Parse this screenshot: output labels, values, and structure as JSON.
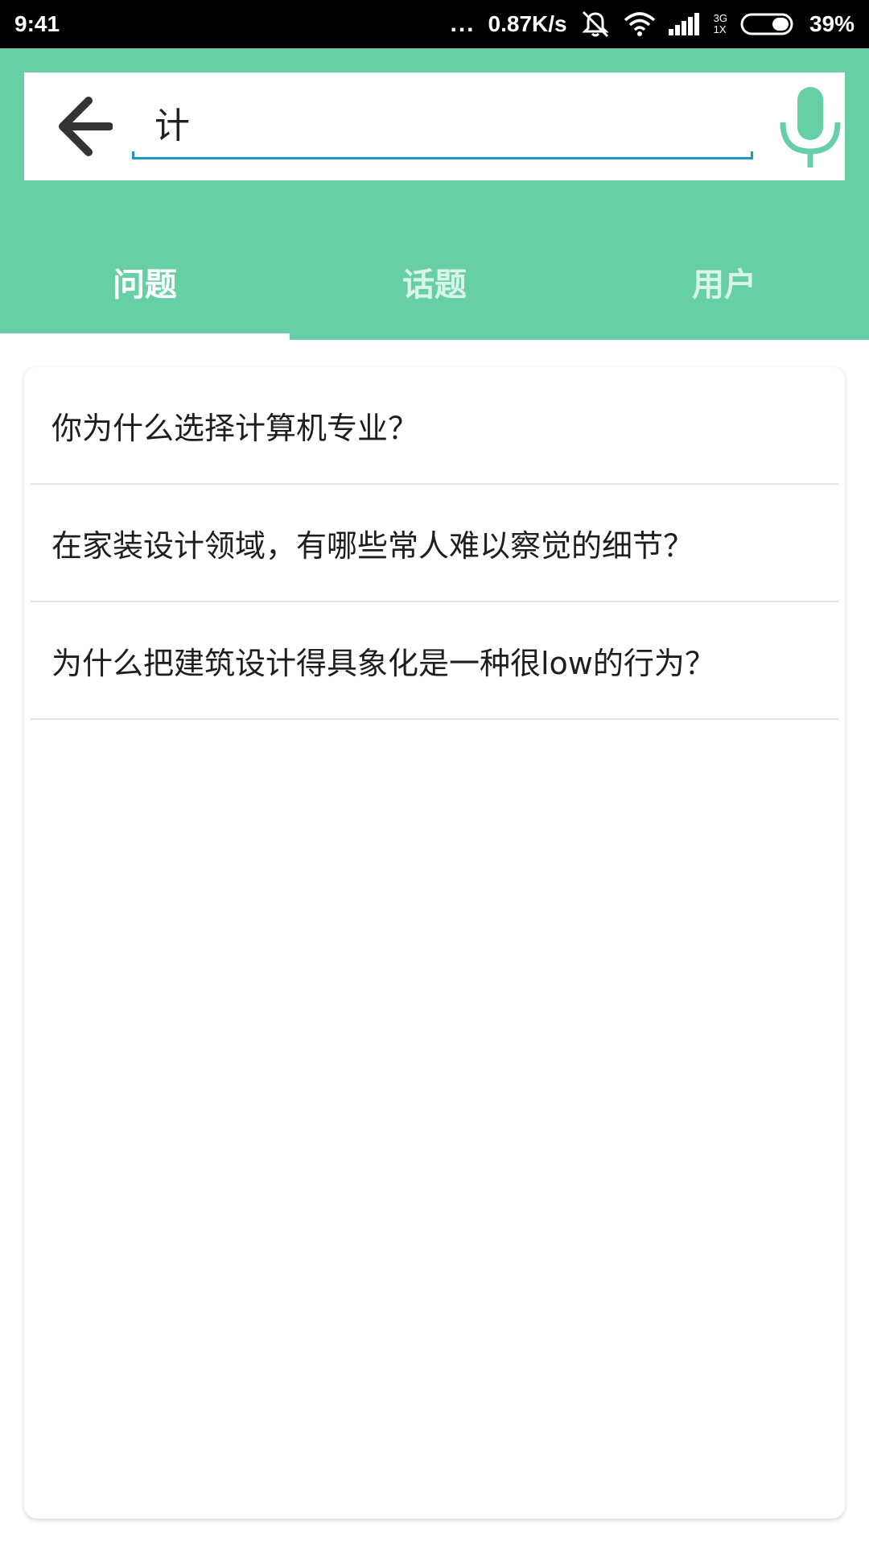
{
  "status_bar": {
    "time": "9:41",
    "more": "...",
    "net_speed": "0.87K/s",
    "network_type": "3G",
    "sim_slot": "1X",
    "battery": "39%",
    "icons": [
      "dots-icon",
      "mute-vibrate-icon",
      "wifi-icon",
      "signal-icon",
      "battery-icon"
    ]
  },
  "search": {
    "query": "计",
    "accent_color": "#1f97c8"
  },
  "tabs": [
    {
      "label": "问题",
      "active": true
    },
    {
      "label": "话题",
      "active": false
    },
    {
      "label": "用户",
      "active": false
    }
  ],
  "results": [
    {
      "title": "你为什么选择计算机专业？"
    },
    {
      "title": "在家装设计领域，有哪些常人难以察觉的细节？"
    },
    {
      "title": "为什么把建筑设计得具象化是一种很low的行为？"
    }
  ],
  "theme": {
    "header_color": "#67cfa6",
    "mic_color": "#67cfa6",
    "back_arrow_color": "#333333"
  }
}
